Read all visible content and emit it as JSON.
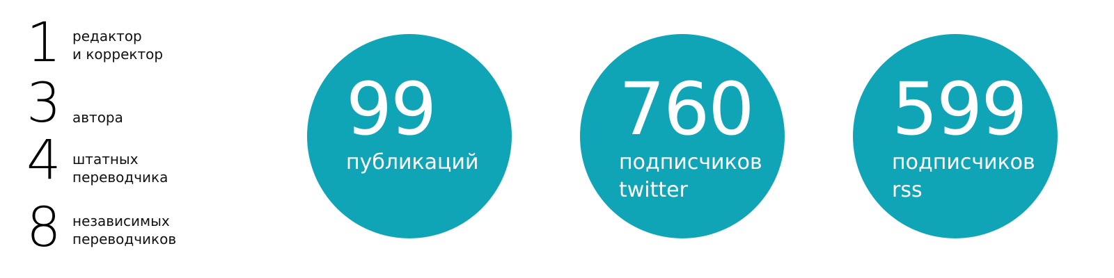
{
  "team": [
    {
      "number": "1",
      "line1": "редактор",
      "line2": "и корректор"
    },
    {
      "number": "3",
      "line1": "автора",
      "line2": ""
    },
    {
      "number": "4",
      "line1": "штатных",
      "line2": "переводчика"
    },
    {
      "number": "8",
      "line1": "независимых",
      "line2": "переводчиков"
    }
  ],
  "stats": [
    {
      "number": "99",
      "line1": "публикаций",
      "line2": ""
    },
    {
      "number": "760",
      "line1": "подписчиков",
      "line2": "twitter"
    },
    {
      "number": "599",
      "line1": "подписчиков",
      "line2": "rss"
    }
  ],
  "colors": {
    "circle": "#0fa5b6",
    "circle_text": "#ffffff",
    "text": "#000000"
  }
}
